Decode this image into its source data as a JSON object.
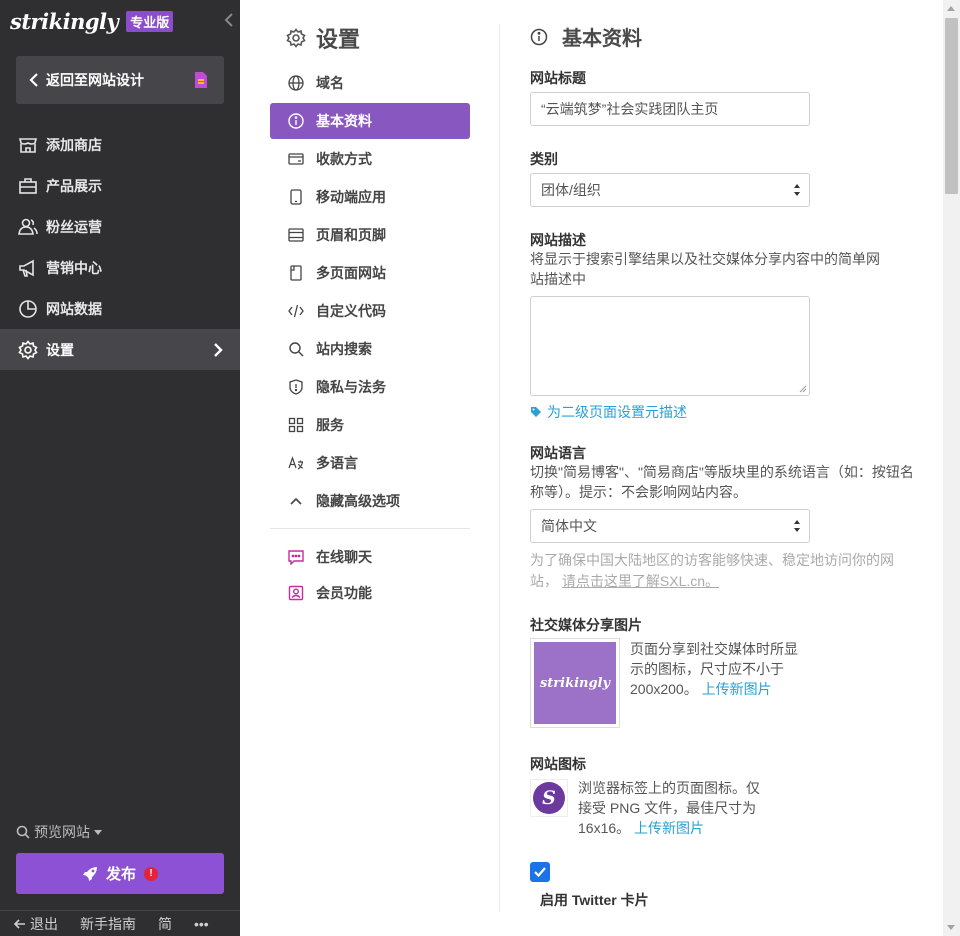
{
  "brand": {
    "logo": "strikingly",
    "badge": "专业版"
  },
  "sidebar": {
    "back_label": "返回至网站设计",
    "items": [
      {
        "label": "添加商店",
        "icon": "store-icon"
      },
      {
        "label": "产品展示",
        "icon": "briefcase-icon"
      },
      {
        "label": "粉丝运营",
        "icon": "users-icon"
      },
      {
        "label": "营销中心",
        "icon": "megaphone-icon"
      },
      {
        "label": "网站数据",
        "icon": "pie-chart-icon"
      },
      {
        "label": "设置",
        "icon": "gear-icon",
        "active": true
      }
    ],
    "preview_label": "预览网站",
    "publish_label": "发布",
    "publish_alert": "!",
    "footer": {
      "logout": "退出",
      "guide": "新手指南",
      "lang": "简",
      "more": "•••"
    }
  },
  "settings": {
    "title": "设置",
    "menu": [
      {
        "label": "域名",
        "icon": "globe-icon"
      },
      {
        "label": "基本资料",
        "icon": "info-icon",
        "active": true
      },
      {
        "label": "收款方式",
        "icon": "wallet-icon"
      },
      {
        "label": "移动端应用",
        "icon": "mobile-icon"
      },
      {
        "label": "页眉和页脚",
        "icon": "layout-icon"
      },
      {
        "label": "多页面网站",
        "icon": "pages-icon"
      },
      {
        "label": "自定义代码",
        "icon": "code-icon"
      },
      {
        "label": "站内搜索",
        "icon": "search-icon"
      },
      {
        "label": "隐私与法务",
        "icon": "shield-icon"
      },
      {
        "label": "服务",
        "icon": "grid-icon"
      },
      {
        "label": "多语言",
        "icon": "translate-icon"
      },
      {
        "label": "隐藏高级选项",
        "icon": "chevron-up-icon"
      }
    ],
    "extra": [
      {
        "label": "在线聊天",
        "icon": "chat-icon"
      },
      {
        "label": "会员功能",
        "icon": "member-icon"
      }
    ]
  },
  "main": {
    "title": "基本资料",
    "site_title_label": "网站标题",
    "site_title_value": "“云端筑梦”社会实践团队主页",
    "category_label": "类别",
    "category_value": "团体/组织",
    "desc_label": "网站描述",
    "desc_help": "将显示于搜索引擎结果以及社交媒体分享内容中的简单网站描述中",
    "desc_link": "为二级页面设置元描述",
    "lang_label": "网站语言",
    "lang_help": "切换\"简易博客\"、\"简易商店\"等版块里的系统语言（如：按钮名称等）。提示：不会影响网站内容。",
    "lang_value": "简体中文",
    "note_text": "为了确保中国大陆地区的访客能够快速、稳定地访问你的网站，",
    "note_link": "请点击这里了解SXL.cn。",
    "social_label": "社交媒体分享图片",
    "social_thumb_text": "strikingly",
    "social_help": "页面分享到社交媒体时所显示的图标，尺寸应不小于200x200。",
    "social_upload": "上传新图片",
    "favicon_label": "网站图标",
    "favicon_letter": "S",
    "favicon_help": "浏览器标签上的页面图标。仅接受 PNG 文件，最佳尺寸为 16x16。",
    "favicon_upload": "上传新图片",
    "twitter_label": "启用 Twitter 卡片",
    "twitter_checked": true
  },
  "colors": {
    "accent": "#8858c0",
    "sidebar_bg": "#2f2f32",
    "link": "#2aa0d6",
    "publish": "#8c51d4",
    "alert": "#e4223a"
  }
}
